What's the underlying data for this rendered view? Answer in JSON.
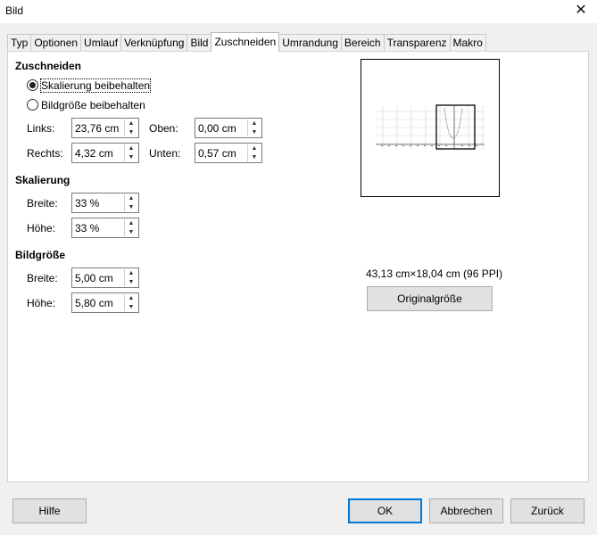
{
  "window": {
    "title": "Bild",
    "close_symbol": "✕"
  },
  "tabs": [
    {
      "label": "Typ",
      "active": false
    },
    {
      "label": "Optionen",
      "active": false
    },
    {
      "label": "Umlauf",
      "active": false
    },
    {
      "label": "Verknüpfung",
      "active": false
    },
    {
      "label": "Bild",
      "active": false
    },
    {
      "label": "Zuschneiden",
      "active": true
    },
    {
      "label": "Umrandung",
      "active": false
    },
    {
      "label": "Bereich",
      "active": false
    },
    {
      "label": "Transparenz",
      "active": false
    },
    {
      "label": "Makro",
      "active": false
    }
  ],
  "crop": {
    "title": "Zuschneiden",
    "keep_scale": {
      "label": "Skalierung beibehalten",
      "selected": true
    },
    "keep_size": {
      "label": "Bildgröße beibehalten",
      "selected": false
    },
    "left": {
      "label": "Links:",
      "value": "23,76 cm"
    },
    "right": {
      "label": "Rechts:",
      "value": "4,32 cm"
    },
    "top": {
      "label": "Oben:",
      "value": "0,00 cm"
    },
    "bottom": {
      "label": "Unten:",
      "value": "0,57 cm"
    }
  },
  "scale": {
    "title": "Skalierung",
    "width": {
      "label": "Breite:",
      "value": "33 %"
    },
    "height": {
      "label": "Höhe:",
      "value": "33 %"
    }
  },
  "image_size": {
    "title": "Bildgröße",
    "width": {
      "label": "Breite:",
      "value": "5,00 cm"
    },
    "height": {
      "label": "Höhe:",
      "value": "5,80 cm"
    }
  },
  "original": {
    "info": "43,13 cm×18,04 cm (96 PPI)",
    "button": "Originalgröße"
  },
  "footer": {
    "help": "Hilfe",
    "ok": "OK",
    "cancel": "Abbrechen",
    "reset": "Zurück"
  },
  "spin_up_symbol": "▲",
  "spin_down_symbol": "▼"
}
